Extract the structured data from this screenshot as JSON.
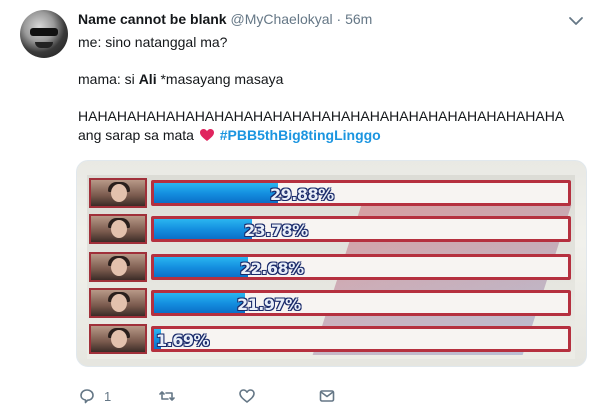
{
  "tweet": {
    "display_name": "Name cannot be blank",
    "handle": "@MyChaelokyal",
    "separator": "·",
    "time": "56m",
    "lines": {
      "l1": "me: sino natanggal ma?",
      "l2_pre": "mama: si ",
      "l2_bold": "Ali",
      "l2_post": " *masayang masaya",
      "l3": "HAHAHAHAHAHAHAHAHAHAHAHAHAHAHAHAHAHAHAHAHAHAHAHAHA",
      "l4_pre": "ang sarap sa mata",
      "hashtag": "#PBB5thBig8tingLinggo"
    },
    "actions": {
      "reply_count": "1",
      "retweet_count": "",
      "like_count": ""
    }
  },
  "poll": {
    "rows": [
      {
        "label": "29.88%",
        "value": 29.88
      },
      {
        "label": "23.78%",
        "value": 23.78
      },
      {
        "label": "22.68%",
        "value": 22.68
      },
      {
        "label": "21.97%",
        "value": 21.97
      },
      {
        "label": "1.69%",
        "value": 1.69
      }
    ]
  },
  "colors": {
    "hashtag": "#1b95e0",
    "heart": "#e0245e",
    "muted": "#657786",
    "bar_fill": "#1590e0",
    "bar_border": "#b5303f"
  },
  "icons": {
    "reply": "reply-icon",
    "retweet": "retweet-icon",
    "like": "heart-icon",
    "dm": "envelope-icon",
    "more": "chevron-down-icon"
  }
}
